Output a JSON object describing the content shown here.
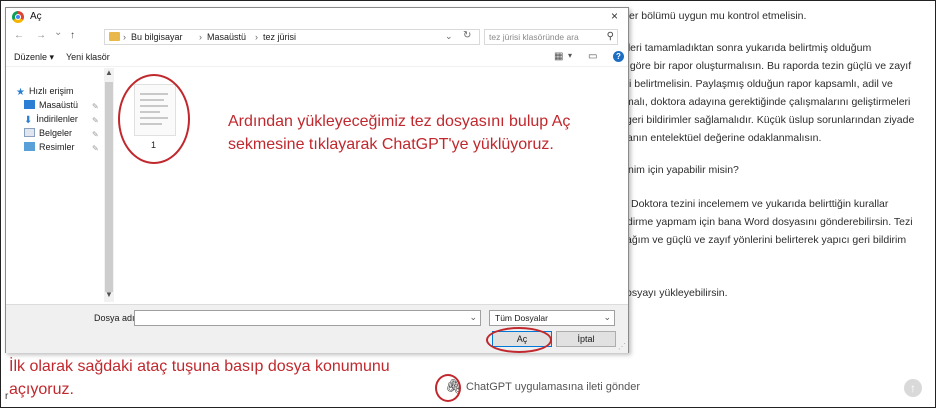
{
  "dialog": {
    "title": "Aç",
    "close_glyph": "×",
    "nav": {
      "back": "←",
      "forward": "→",
      "dropdown": "⌄",
      "up": "↑"
    },
    "breadcrumb": [
      "Bu bilgisayar",
      "Masaüstü",
      "tez jürisi"
    ],
    "breadcrumb_sep": "›",
    "search_placeholder": "tez jürisi klasöründe ara",
    "toolbar": {
      "organize": "Düzenle ▾",
      "new_folder": "Yeni klasör"
    },
    "sidebar": [
      {
        "label": "Hızlı erişim",
        "icon": "star-icon"
      },
      {
        "label": "Masaüstü",
        "icon": "desktop-icon"
      },
      {
        "label": "İndirilenler",
        "icon": "download-icon"
      },
      {
        "label": "Belgeler",
        "icon": "documents-icon"
      },
      {
        "label": "Resimler",
        "icon": "pictures-icon"
      }
    ],
    "file": {
      "name": "1"
    },
    "filename_label": "Dosya adı:",
    "filetype": "Tüm Dosyalar",
    "open_button": "Aç",
    "cancel_button": "İptal"
  },
  "annotations": {
    "center_line1": "Ardından yükleyeceğimiz tez dosyasını bulup Aç",
    "center_line2": "sekmesine tıklayarak ChatGPT'ye yüklüyoruz.",
    "left_line1": "İlk olarak sağdaki ataç tuşuna basıp dosya konumunu",
    "left_line2": "açıyoruz."
  },
  "chat": {
    "lines": [
      "er bölümü uygun mu kontrol etmelisin.",
      "eleri tamamladıktan sonra yukarıda belirtmiş olduğum",
      "ı göre bir rapor oluşturmalısın. Bu raporda tezin güçlü ve zayıf",
      "i belirtmelisin. Paylaşmış olduğun rapor kapsamlı, adil ve",
      "malı, doktora adayına gerektiğinde çalışmalarını geliştirmeleri",
      "geri bildirimler sağlamalıdır. Küçük üslup sorunlarından ziyade",
      "anın entelektüel değerine odaklanmalısın.",
      "nim için yapabilir misin?",
      "Doktora tezini incelemem ve yukarıda belirttiğin kurallar",
      "dirme yapmam için bana Word dosyasını gönderebilirsin. Tezi",
      "ağım ve güçlü ve zayıf yönlerini belirterek yapıcı geri bildirim",
      "osyayı yükleyebilirsin."
    ],
    "input_placeholder": "ChatGPT uygulamasına ileti gönder",
    "send_glyph": "↑",
    "attach_glyph": "🖇"
  },
  "misc": {
    "stray_letter": "r"
  },
  "colors": {
    "annotation_red": "#c0282d",
    "folder_yellow": "#e8b94a",
    "accent_blue": "#0078d7"
  }
}
